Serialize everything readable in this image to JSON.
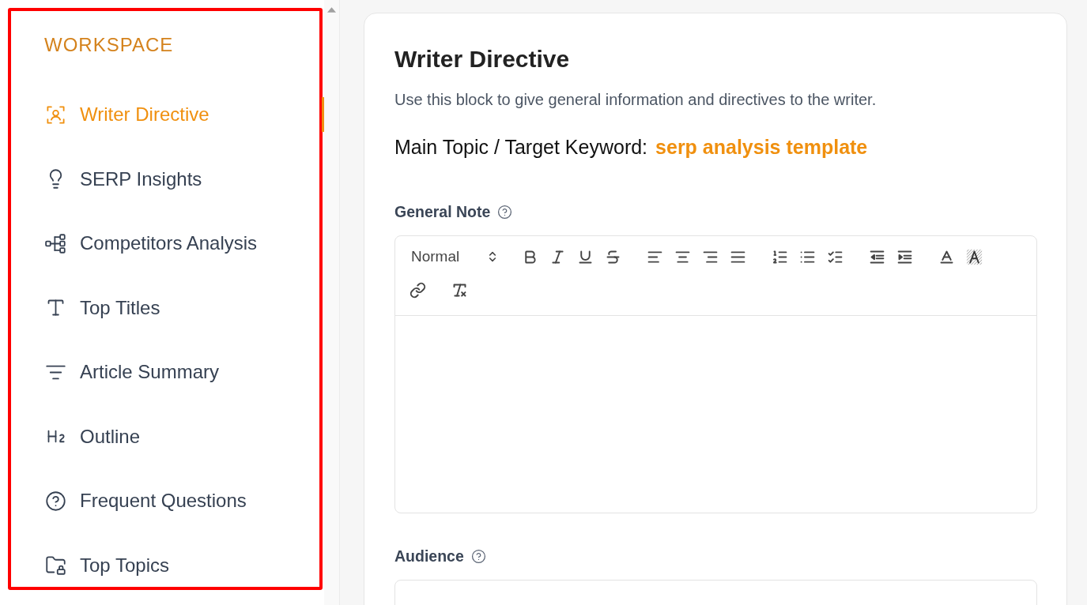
{
  "sidebar": {
    "title": "WORKSPACE",
    "items": [
      {
        "label": "Writer Directive",
        "selected": true
      },
      {
        "label": "SERP Insights",
        "selected": false
      },
      {
        "label": "Competitors Analysis",
        "selected": false
      },
      {
        "label": "Top Titles",
        "selected": false
      },
      {
        "label": "Article Summary",
        "selected": false
      },
      {
        "label": "Outline",
        "selected": false
      },
      {
        "label": "Frequent Questions",
        "selected": false
      },
      {
        "label": "Top Topics",
        "selected": false
      }
    ]
  },
  "main": {
    "title": "Writer Directive",
    "description": "Use this block to give general information and directives to the writer.",
    "keyword_label": "Main Topic / Target Keyword:",
    "keyword": "serp analysis template",
    "fields": [
      {
        "kind": "editor",
        "label": "General Note",
        "format": "Normal"
      },
      {
        "kind": "text",
        "label": "Audience"
      }
    ]
  }
}
